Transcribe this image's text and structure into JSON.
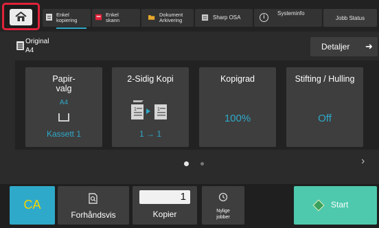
{
  "topbar": {
    "tabs": [
      {
        "line1": "Enkel",
        "line2": "kopiering",
        "icon": "copy-icon",
        "active": true
      },
      {
        "line1": "Enkel",
        "line2": "skann",
        "icon": "scan-icon",
        "active": false
      },
      {
        "line1": "Dokument",
        "line2": "Arkivering",
        "icon": "folder-icon",
        "active": false
      },
      {
        "line1": "Sharp OSA",
        "line2": "",
        "icon": "osa-icon",
        "active": false
      },
      {
        "line1": "Systeminfo",
        "line2": "",
        "icon": "info-icon",
        "active": false
      }
    ],
    "job_status": "Jobb Status",
    "home_icon": "home-icon"
  },
  "original": {
    "label": "Original",
    "size": "A4"
  },
  "details": {
    "label": "Detaljer",
    "icon": "arrow-right-icon"
  },
  "panels": [
    {
      "title_line1": "Papir-",
      "title_line2": "valg",
      "value_top": "A4",
      "value_bottom": "Kassett 1",
      "icon": "tray-icon"
    },
    {
      "title_line1": "2-Sidig Kopi",
      "title_line2": "",
      "value_bottom": "1 → 1",
      "icon": "duplex-icon"
    },
    {
      "title_line1": "Kopigrad",
      "title_line2": "",
      "value_center": "100%"
    },
    {
      "title_line1": "Stifting / Hulling",
      "title_line2": "",
      "value_center": "Off"
    }
  ],
  "pager": {
    "pages": 2,
    "current": 1
  },
  "bottom": {
    "ca_label": "CA",
    "preview_label": "Forhåndsvis",
    "copies_value": "1",
    "copies_label": "Kopier",
    "recent_line1": "Nylige",
    "recent_line2": "jobber",
    "start_label": "Start"
  },
  "colors": {
    "accent": "#2fa9c9",
    "start": "#4ec9ad",
    "ca_text": "#f4d400",
    "home_highlight": "#e2223a"
  }
}
